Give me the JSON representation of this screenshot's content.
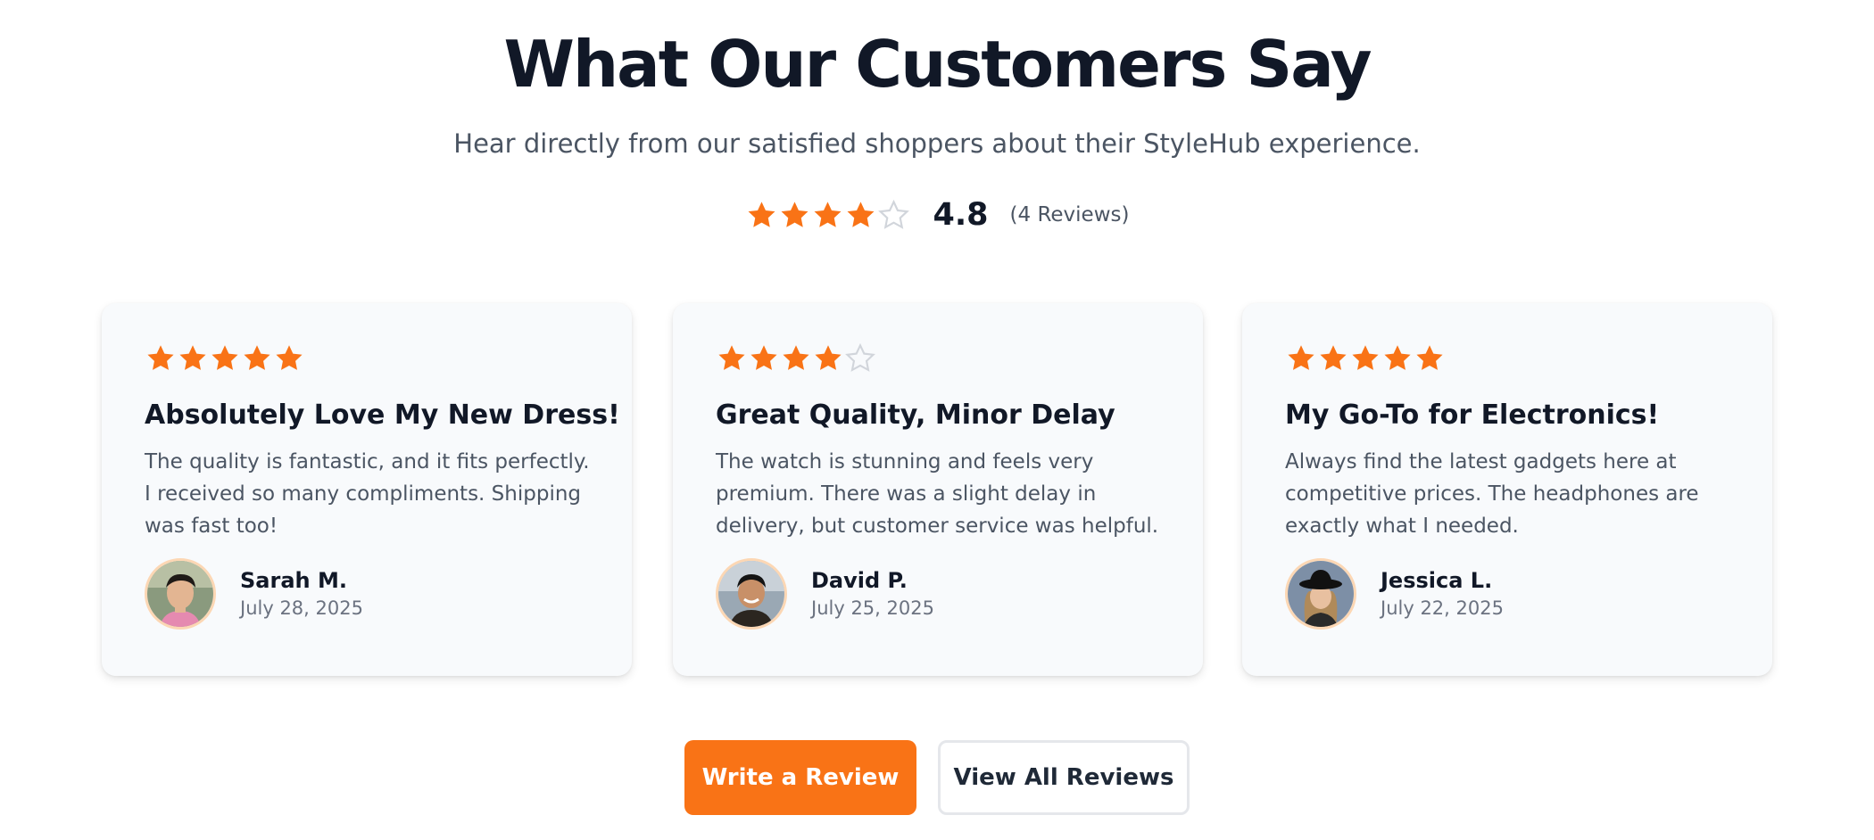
{
  "header": {
    "title": "What Our Customers Say",
    "subtitle": "Hear directly from our satisfied shoppers about their StyleHub experience."
  },
  "overall_rating": {
    "score": "4.8",
    "filled_stars": 4,
    "total_stars": 5,
    "count_label": "(4 Reviews)"
  },
  "colors": {
    "accent": "#f97316",
    "star_filled": "#f97316",
    "star_empty": "#d1d5db",
    "heading": "#111827",
    "body_text": "#4b5563",
    "card_background": "#f8fafc"
  },
  "reviews": [
    {
      "rating": 5,
      "title": "Absolutely Love My New Dress!",
      "text": "The quality is fantastic, and it fits perfectly. I received so many compliments. Shipping was fast too!",
      "name": "Sarah M.",
      "date": "July 28, 2025",
      "avatar_icon": "avatar-photo"
    },
    {
      "rating": 4,
      "title": "Great Quality, Minor Delay",
      "text": "The watch is stunning and feels very premium. There was a slight delay in delivery, but customer service was helpful.",
      "name": "David P.",
      "date": "July 25, 2025",
      "avatar_icon": "avatar-photo"
    },
    {
      "rating": 5,
      "title": "My Go-To for Electronics!",
      "text": "Always find the latest gadgets here at competitive prices. The headphones are exactly what I needed.",
      "name": "Jessica L.",
      "date": "July 22, 2025",
      "avatar_icon": "avatar-photo"
    }
  ],
  "actions": {
    "write_review_label": "Write a Review",
    "view_all_label": "View All Reviews"
  }
}
